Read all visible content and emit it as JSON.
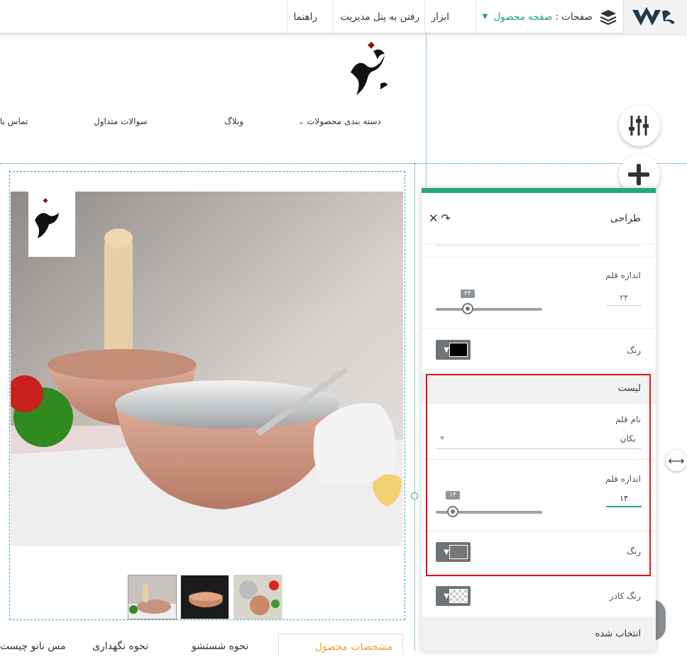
{
  "topbar": {
    "pages_label": "صفحات :",
    "pages_value": "صفحه محصول",
    "tools": "ابزار",
    "admin_panel": "رفتن به پنل مدیریت",
    "help": "راهنما"
  },
  "nav": {
    "categories": "دسته بندی محصولات",
    "blog": "وبلاگ",
    "faq": "سوالات متداول",
    "contact": "تماس با"
  },
  "product_tabs": {
    "specs": "مشخصات محصول",
    "wash": "نحوه شستشو",
    "keep": "نحوه نگهداری",
    "copper": "مس نانو چیست"
  },
  "panel": {
    "title": "طراحی",
    "font_size_label": "اندازه قلم",
    "font_size_value": "۲۴",
    "font_size_tip": "۲۴",
    "font_size_fraction": 0.3,
    "color_label": "رنگ",
    "color_value": "#000000",
    "list_section": "لیست",
    "font_name_label": "نام قلم",
    "font_name_value": "یکان",
    "list_font_size_label": "اندازه قلم",
    "list_font_size_value": "۱۳",
    "list_font_size_tip": "۱۳",
    "list_font_size_fraction": 0.16,
    "list_color_label": "رنگ",
    "list_color_value": "#777777",
    "frame_color_label": "رنگ کادر",
    "selected_section": "انتخاب شده"
  },
  "colors": {
    "accent": "#1fa67a",
    "highlight": "#e0141a",
    "tab_active": "#f0a020"
  }
}
